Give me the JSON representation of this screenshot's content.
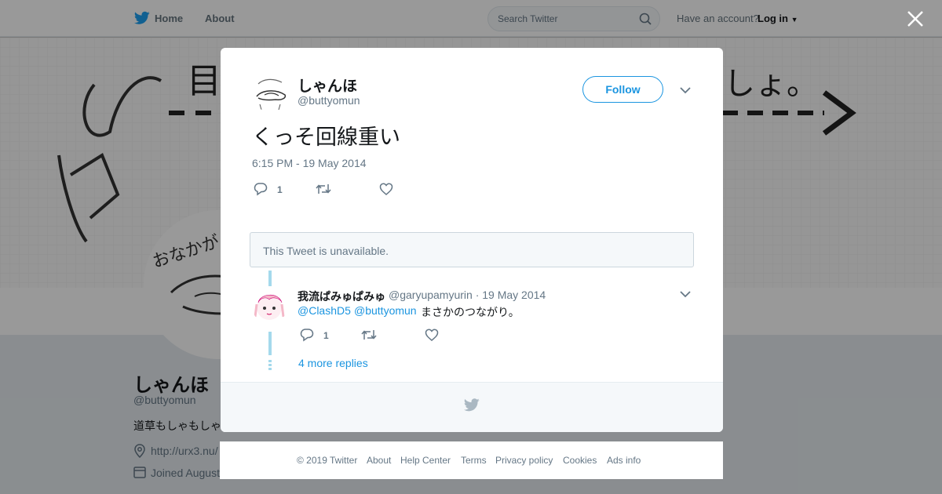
{
  "topbar": {
    "home_label": "Home",
    "about_label": "About",
    "search_placeholder": "Search Twitter",
    "have_account": "Have an account?",
    "login_label": "Log in"
  },
  "profile": {
    "name": "しゃんほ",
    "handle": "@buttyomun",
    "bio": "道草もしゃもしゃ",
    "url": "http://urx3.nu/",
    "joined": "Joined August"
  },
  "tweet": {
    "author_name": "しゃんほ",
    "author_handle": "@buttyomun",
    "follow_label": "Follow",
    "text": "くっそ回線重い",
    "timestamp": "6:15 PM - 19 May 2014",
    "reply_count": "1",
    "retweet_count": "",
    "like_count": ""
  },
  "unavailable_text": "This Tweet is unavailable.",
  "reply": {
    "author_name": "我流ぱみゅぱみゅ",
    "meta": "@garyupamyurin · 19 May 2014",
    "mention_1": "@ClashD5",
    "mention_2": "@buttyomun",
    "text": "まさかのつながり。",
    "reply_count": "1",
    "retweet_count": "",
    "like_count": ""
  },
  "more_replies_label": "4 more replies",
  "footer": {
    "copyright": "© 2019 Twitter",
    "about": "About",
    "help": "Help Center",
    "terms": "Terms",
    "privacy": "Privacy policy",
    "cookies": "Cookies",
    "ads": "Ads info"
  },
  "colors": {
    "brand_blue": "#1da1f2",
    "link_blue": "#1b95e0",
    "thread_line": "#a4d9ec",
    "overlay": "rgba(0,0,0,0.40)"
  },
  "icons": [
    "twitter-bird-icon",
    "search-icon",
    "caret-down-icon",
    "close-icon",
    "reply-icon",
    "retweet-icon",
    "like-icon",
    "chevron-down-icon",
    "location-icon",
    "calendar-icon"
  ]
}
